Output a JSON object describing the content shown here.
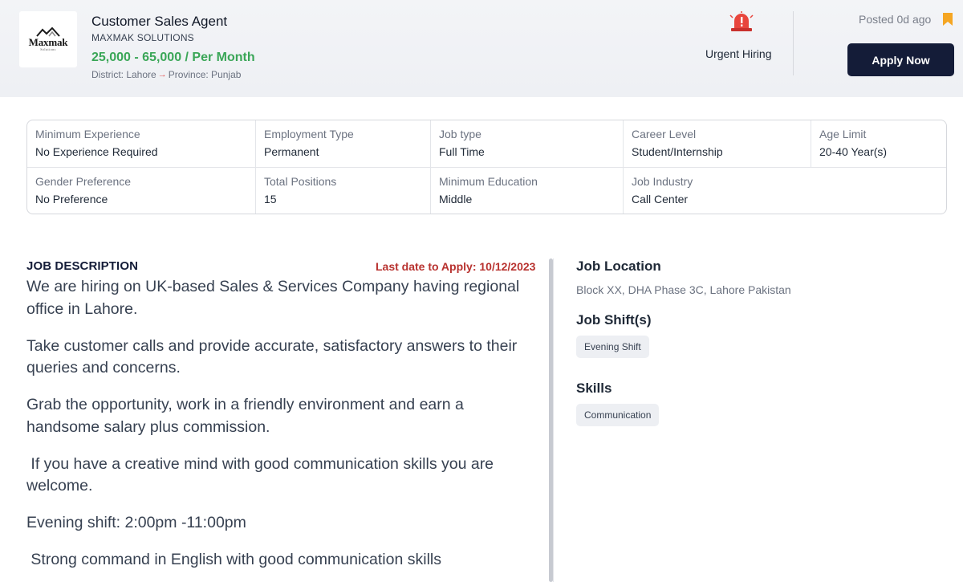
{
  "header": {
    "logo": {
      "name": "Maxmak",
      "subtitle": "Solutions"
    },
    "job_title": "Customer Sales Agent",
    "company": "MAXMAK SOLUTIONS",
    "salary": "25,000 - 65,000 / Per Month",
    "district": "District: Lahore",
    "province": "Province: Punjab",
    "urgent_label": "Urgent Hiring",
    "posted": "Posted 0d ago",
    "apply_label": "Apply Now",
    "colors": {
      "salary": "#3aa657",
      "apply_bg": "#141c38",
      "urgent": "#e8453c",
      "bookmark": "#f5a623"
    }
  },
  "details": {
    "row1": [
      {
        "label": "Minimum Experience",
        "value": "No Experience Required"
      },
      {
        "label": "Employment Type",
        "value": "Permanent"
      },
      {
        "label": "Job type",
        "value": "Full Time"
      },
      {
        "label": "Career Level",
        "value": "Student/Internship"
      },
      {
        "label": "Age Limit",
        "value": "20-40 Year(s)"
      }
    ],
    "row2": [
      {
        "label": "Gender Preference",
        "value": "No Preference"
      },
      {
        "label": "Total Positions",
        "value": "15"
      },
      {
        "label": "Minimum Education",
        "value": "Middle"
      },
      {
        "label": "Job Industry",
        "value": "Call Center"
      }
    ]
  },
  "description": {
    "heading": "JOB DESCRIPTION",
    "last_date": "Last date to Apply: 10/12/2023",
    "paragraphs": [
      "We are hiring on UK-based Sales & Services Company having regional office in Lahore.",
      "Take customer calls and provide accurate, satisfactory answers to their queries and concerns.",
      "Grab the opportunity, work in a friendly environment and earn a handsome salary plus commission.",
      " If you have a creative mind with good communication skills you are welcome.",
      "Evening shift: 2:00pm -11:00pm",
      " Strong command in English with good communication skills"
    ]
  },
  "sidebar": {
    "location_heading": "Job Location",
    "location": "Block XX, DHA Phase 3C, Lahore Pakistan",
    "shift_heading": "Job Shift(s)",
    "shift_chip": "Evening Shift",
    "skills_heading": "Skills",
    "skills_chip": "Communication"
  }
}
